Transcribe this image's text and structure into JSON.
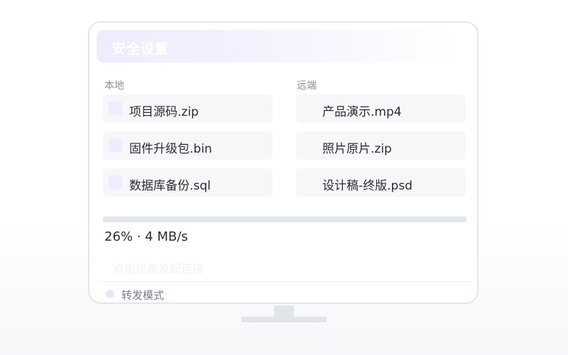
{
  "header": {
    "title": "安全设置"
  },
  "local": {
    "label": "本地",
    "files": [
      {
        "name": "项目源码.zip",
        "icon": "file-icon"
      },
      {
        "name": "固件升级包.bin",
        "icon": "file-icon"
      },
      {
        "name": "数据库备份.sql",
        "icon": "file-icon"
      }
    ]
  },
  "remote": {
    "label": "远端",
    "files": [
      {
        "name": "产品演示.mp4"
      },
      {
        "name": "照片原片.zip"
      },
      {
        "name": "设计稿-终版.psd"
      }
    ]
  },
  "transfer": {
    "progress_percent": 26,
    "status_text": "26% · 4 MB/s"
  },
  "hint": {
    "text": "点击设备发起连接"
  },
  "mode": {
    "label": "转发模式"
  },
  "colors": {
    "accent": "#ebe7fb",
    "header_gradient_start": "#efebfd",
    "panel_background": "#f6f7f9",
    "text_primary": "#2a2d34",
    "text_secondary": "#8a8f99"
  }
}
